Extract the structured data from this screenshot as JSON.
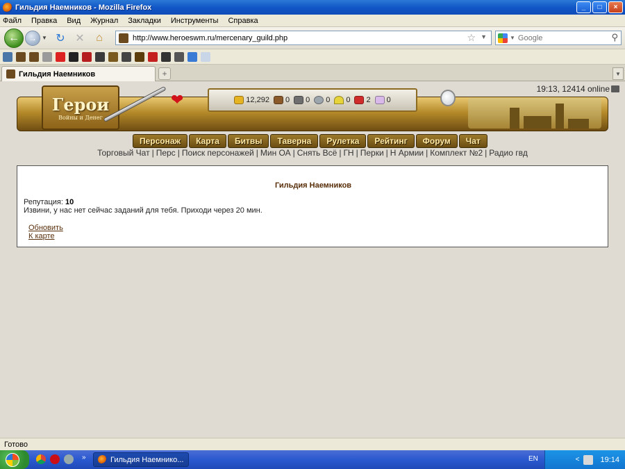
{
  "window": {
    "title": "Гильдия Наемников - Mozilla Firefox",
    "controls": [
      "_",
      "□",
      "×"
    ]
  },
  "menu": [
    "Файл",
    "Правка",
    "Вид",
    "Журнал",
    "Закладки",
    "Инструменты",
    "Справка"
  ],
  "nav": {
    "url": "http://www.heroeswm.ru/mercenary_guild.php",
    "search_placeholder": "Google"
  },
  "tabs": [
    {
      "label": "Гильдия Наемников",
      "active": true
    }
  ],
  "game": {
    "status_line": "19:13, 12414 online",
    "logo_main": "Герои",
    "logo_sub": "Войны и Денег",
    "resources": [
      {
        "key": "gold",
        "value": "12,292"
      },
      {
        "key": "wood",
        "value": "0"
      },
      {
        "key": "ore",
        "value": "0"
      },
      {
        "key": "mercury",
        "value": "0"
      },
      {
        "key": "sulfur",
        "value": "0"
      },
      {
        "key": "crystal",
        "value": "2"
      },
      {
        "key": "gems",
        "value": "0"
      }
    ],
    "menu": [
      "Персонаж",
      "Карта",
      "Битвы",
      "Таверна",
      "Рулетка",
      "Рейтинг",
      "Форум",
      "Чат"
    ],
    "quick_links": [
      "Торговый Чат",
      "Перс",
      "Поиск персонажей",
      "Мин ОА",
      "Снять Всё",
      "ГН",
      "Перки",
      "Н Армии",
      "Комплект №2",
      "Радио гвд"
    ]
  },
  "guild": {
    "title": "Гильдия Наемников",
    "reputation_label": "Репутация:",
    "reputation_value": "10",
    "message": "Извини, у нас нет сейчас заданий для тебя. Приходи через 20 мин.",
    "refresh_link": "Обновить",
    "map_link": "К карте"
  },
  "status_bar": "Готово",
  "taskbar": {
    "active_window": "Гильдия Наемнико...",
    "language": "EN",
    "clock": "19:14"
  },
  "colors": {
    "page_bg": "#dfdbd2",
    "guild_text": "#582e0a",
    "xp_blue": "#2a58cf"
  }
}
